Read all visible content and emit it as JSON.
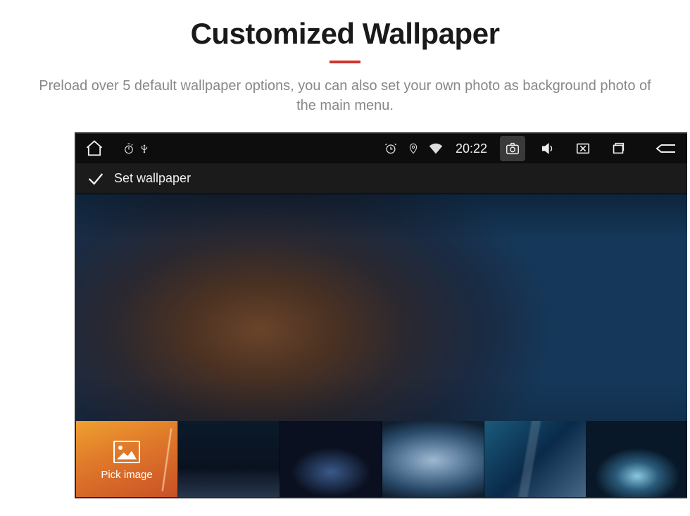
{
  "header": {
    "title": "Customized Wallpaper",
    "subtitle": "Preload over 5 default wallpaper options, you can also set your own photo as background photo of the main menu."
  },
  "status_bar": {
    "time": "20:22",
    "icons": {
      "home": "home-icon",
      "stopwatch": "stopwatch-icon",
      "usb": "usb-icon",
      "alarm": "alarm-icon",
      "location": "location-icon",
      "wifi": "wifi-icon",
      "camera": "camera-icon",
      "volume": "volume-icon",
      "close_screen": "screen-off-icon",
      "recents": "recents-icon",
      "back": "back-icon"
    }
  },
  "action_bar": {
    "confirm_icon": "check-icon",
    "title": "Set wallpaper"
  },
  "thumbnails": {
    "pick_label": "Pick image",
    "items": [
      {
        "name": "wallpaper-streak-blue"
      },
      {
        "name": "wallpaper-planet-horizon"
      },
      {
        "name": "wallpaper-ocean-wave"
      },
      {
        "name": "wallpaper-blue-fold"
      },
      {
        "name": "wallpaper-aurora-dark"
      }
    ]
  }
}
